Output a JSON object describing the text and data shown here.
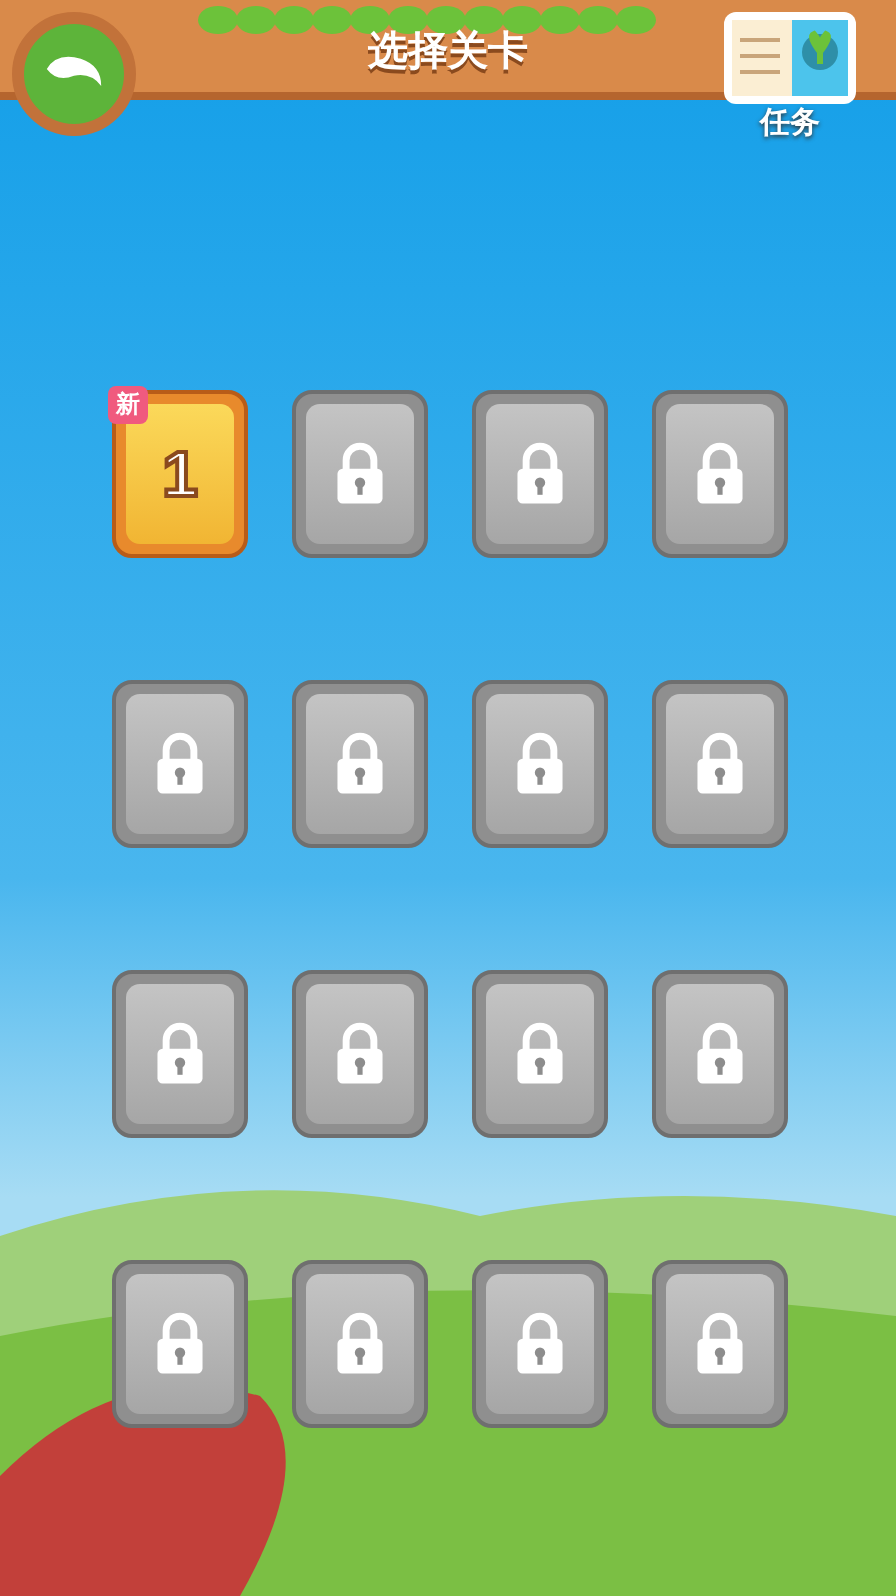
{
  "header": {
    "title": "选择关卡"
  },
  "task_button": {
    "label": "任务"
  },
  "levels": [
    {
      "locked": false,
      "number": "1",
      "badge": "新"
    },
    {
      "locked": true
    },
    {
      "locked": true
    },
    {
      "locked": true
    },
    {
      "locked": true
    },
    {
      "locked": true
    },
    {
      "locked": true
    },
    {
      "locked": true
    },
    {
      "locked": true
    },
    {
      "locked": true
    },
    {
      "locked": true
    },
    {
      "locked": true
    },
    {
      "locked": true
    },
    {
      "locked": true
    },
    {
      "locked": true
    },
    {
      "locked": true
    }
  ]
}
